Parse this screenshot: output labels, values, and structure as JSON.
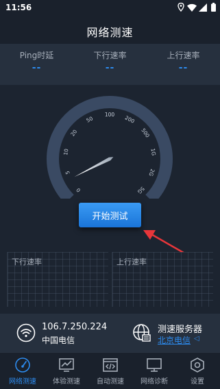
{
  "status_bar": {
    "time": "11:56"
  },
  "header": {
    "title": "网络测速"
  },
  "stats": [
    {
      "label": "Ping时延",
      "value": "--"
    },
    {
      "label": "下行速率",
      "value": "--"
    },
    {
      "label": "上行速率",
      "value": "--"
    }
  ],
  "gauge": {
    "ticks": [
      "0",
      "5",
      "10",
      "20",
      "50",
      "100",
      "200",
      "500",
      "1G",
      "2G",
      "5G"
    ],
    "needle_value": "0"
  },
  "start_button": {
    "label": "开始测试"
  },
  "charts": {
    "download_label": "下行速率",
    "upload_label": "上行速率"
  },
  "network_info": {
    "ip": "106.7.250.224",
    "isp": "中国电信",
    "server_title": "测速服务器",
    "server_name": "北京电信"
  },
  "bottom_nav": [
    {
      "label": "网络测速",
      "icon": "speedometer-icon",
      "active": true
    },
    {
      "label": "体验测速",
      "icon": "chart-icon",
      "active": false
    },
    {
      "label": "自动测速",
      "icon": "code-icon",
      "active": false
    },
    {
      "label": "网络诊断",
      "icon": "monitor-icon",
      "active": false
    },
    {
      "label": "设置",
      "icon": "hexagon-settings-icon",
      "active": false
    }
  ],
  "colors": {
    "background": "#1c2430",
    "panel": "#26303e",
    "accent": "#2d8cf0",
    "arrow": "#e8363a"
  }
}
